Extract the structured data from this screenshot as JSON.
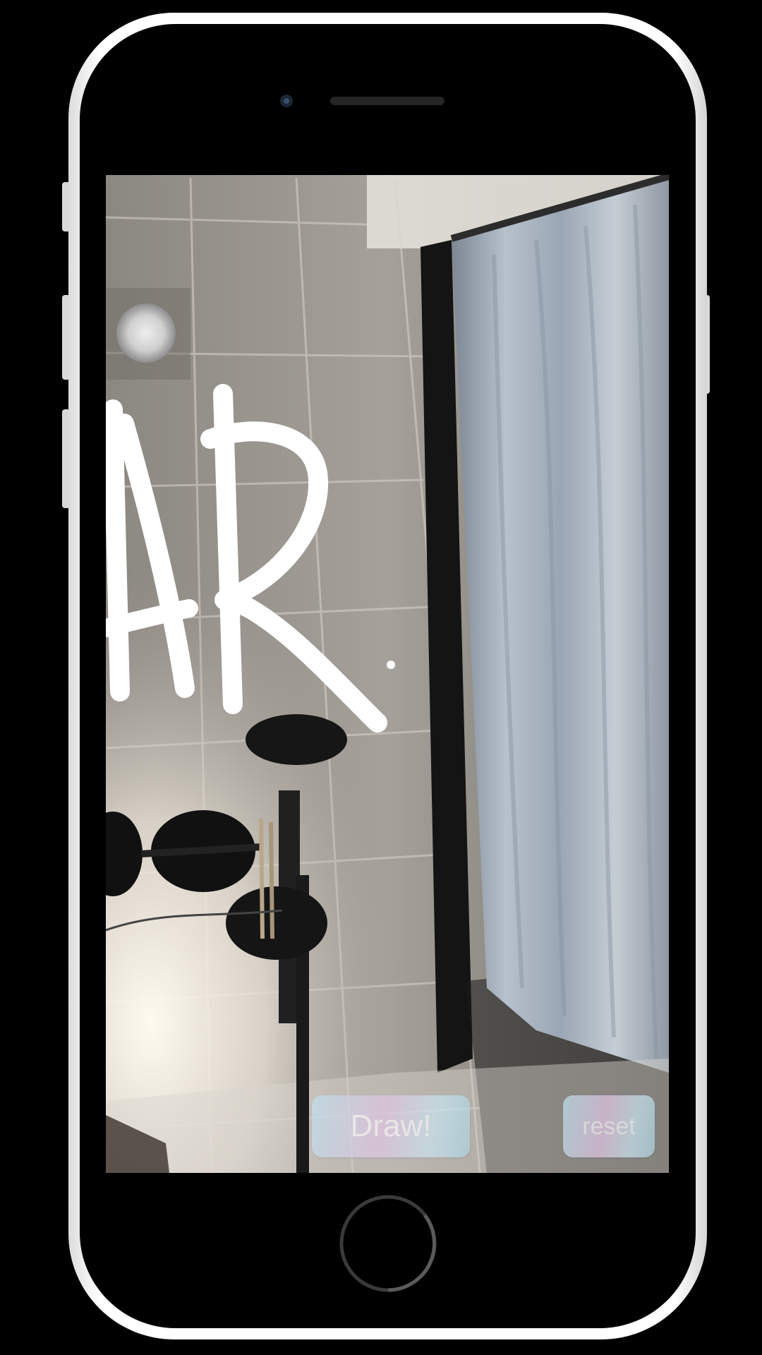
{
  "app": {
    "draw_label": "Draw!",
    "reset_label": "reset"
  },
  "drawing": {
    "content": "AR",
    "stroke_color": "#ffffff"
  },
  "colors": {
    "device_frame": "#f2f2f2",
    "device_face": "#000000",
    "button_gradient": [
      "#bfe1ec",
      "#e0c4e2",
      "#aed3e2"
    ]
  },
  "icons": {
    "camera": "front-camera-icon",
    "speaker": "earpiece-speaker-icon",
    "home": "home-button-icon"
  }
}
